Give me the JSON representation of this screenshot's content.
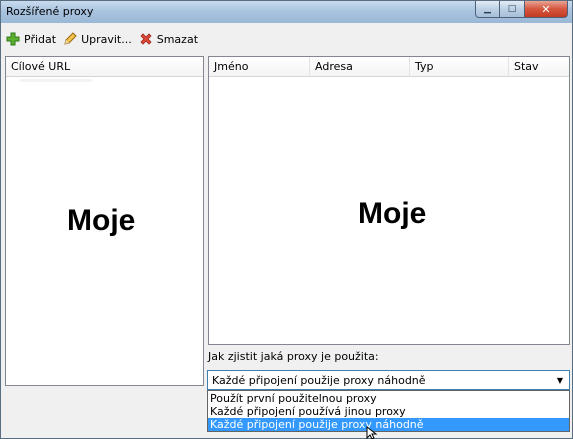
{
  "window": {
    "title": "Rozšířené proxy"
  },
  "toolbar": {
    "add_label": "Přidat",
    "edit_label": "Upravit...",
    "delete_label": "Smazat"
  },
  "left_list": {
    "header": "Cílové URL",
    "watermark": "Moje"
  },
  "right_list": {
    "columns": [
      "Jméno",
      "Adresa",
      "Typ",
      "Stav"
    ],
    "watermark": "Moje"
  },
  "proxy_mode": {
    "label": "Jak zjistit jaká proxy je použita:",
    "selected": "Každé připojení použije proxy náhodně",
    "options": [
      "Použít první použitelnou proxy",
      "Každé připojení používá jinou proxy",
      "Každé připojení použije proxy náhodně"
    ],
    "highlighted_index": 2
  },
  "colors": {
    "selection": "#3399ff",
    "title_gradient_top": "#c9dcee",
    "close_button": "#c33a22"
  },
  "icons": [
    "plus-icon",
    "pencil-icon",
    "delete-x-icon",
    "minimize-icon",
    "maximize-icon",
    "close-icon",
    "dropdown-arrow-icon",
    "mouse-cursor-icon"
  ]
}
